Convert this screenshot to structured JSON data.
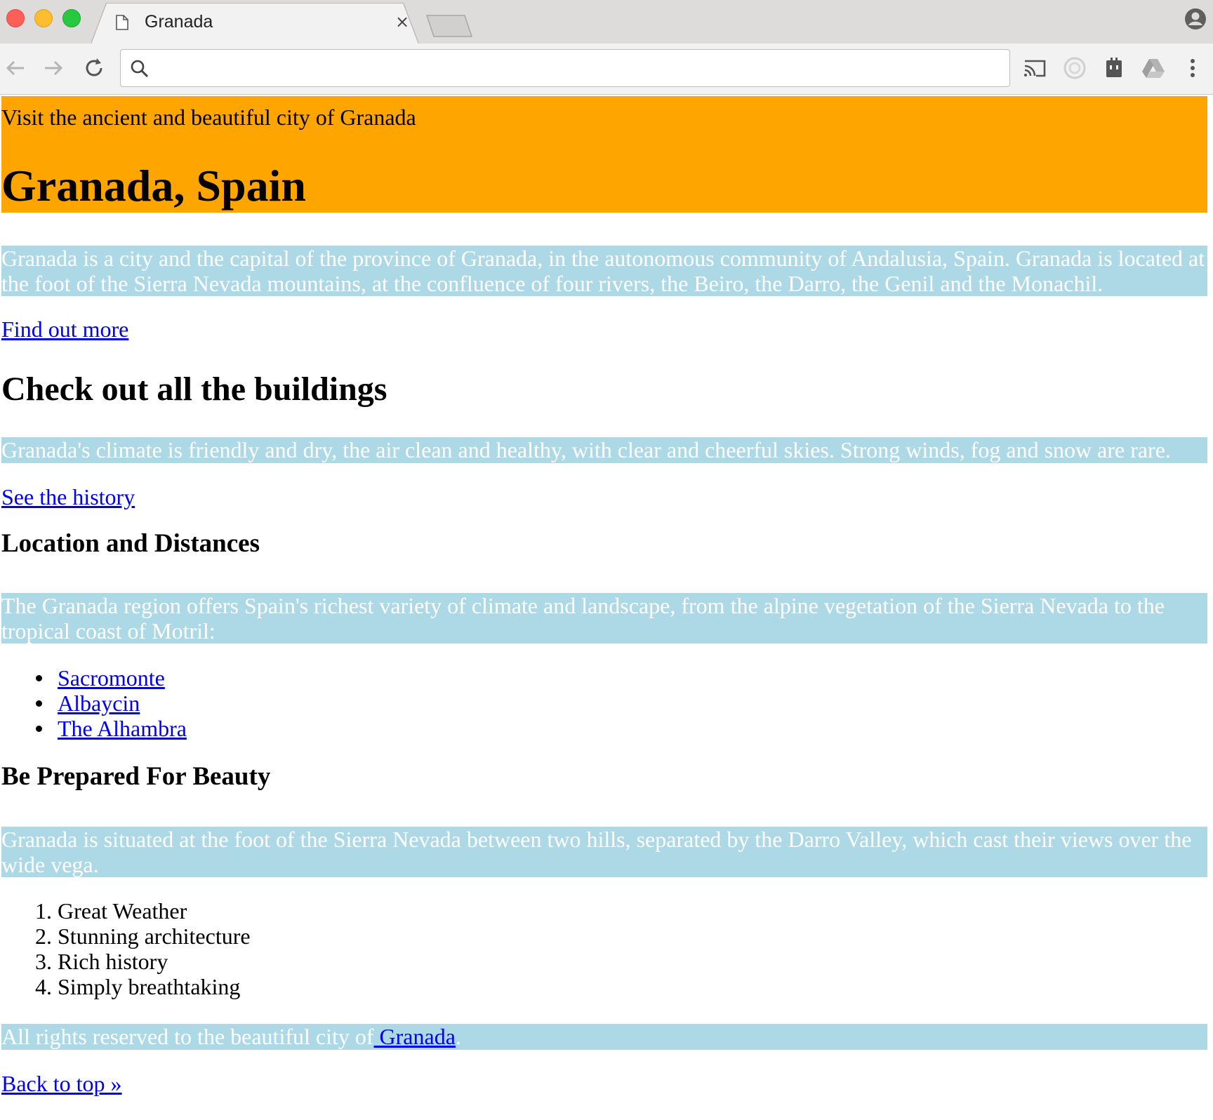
{
  "browser": {
    "tab_title": "Granada",
    "tab_close": "×",
    "omnibox": {
      "value": "",
      "placeholder": ""
    }
  },
  "page": {
    "banner_subtitle": "Visit the ancient and beautiful city of Granada",
    "banner_title": "Granada, Spain",
    "intro_text_line1": "Granada is a city and the capital of the province of Granada, in the autonomous community of Andalusia, Spain. Granada is located at",
    "intro_text_line2": "the foot of the Sierra Nevada mountains, at the confluence of four rivers, the Beiro, the Darro, the Genil and the Monachil.",
    "find_out_more": "Find out more",
    "buildings_heading": "Check out all the buildings",
    "climate_text": "Granada's climate is friendly and dry, the air clean and healthy, with clear and cheerful skies. Strong winds, fog and snow are rare.",
    "see_history": "See the history",
    "location_heading": "Location and Distances",
    "region_text_line1": "The Granada region offers Spain's richest variety of climate and landscape, from the alpine vegetation of the Sierra Nevada to the",
    "region_text_line2": "tropical coast of Motril:",
    "places": [
      "Sacromonte",
      "Albaycin",
      "The Alhambra"
    ],
    "beauty_heading": "Be Prepared For Beauty",
    "situated_text_line1": "Granada is situated at the foot of the Sierra Nevada between two hills, separated by the Darro Valley, which cast their views over the",
    "situated_text_line2": "wide vega.",
    "reasons": [
      "Great Weather",
      "Stunning architecture",
      "Rich history",
      "Simply breathtaking"
    ],
    "reason_numbers": [
      "1.",
      "2.",
      "3.",
      "4."
    ],
    "footer_text": "All rights reserved to the beautiful city of",
    "footer_link": " Granada",
    "footer_period": ".",
    "back_to_top": "Back to top »"
  },
  "colors": {
    "banner": "#ffa500",
    "highlight": "#add8e6",
    "link": "#0000ee"
  }
}
